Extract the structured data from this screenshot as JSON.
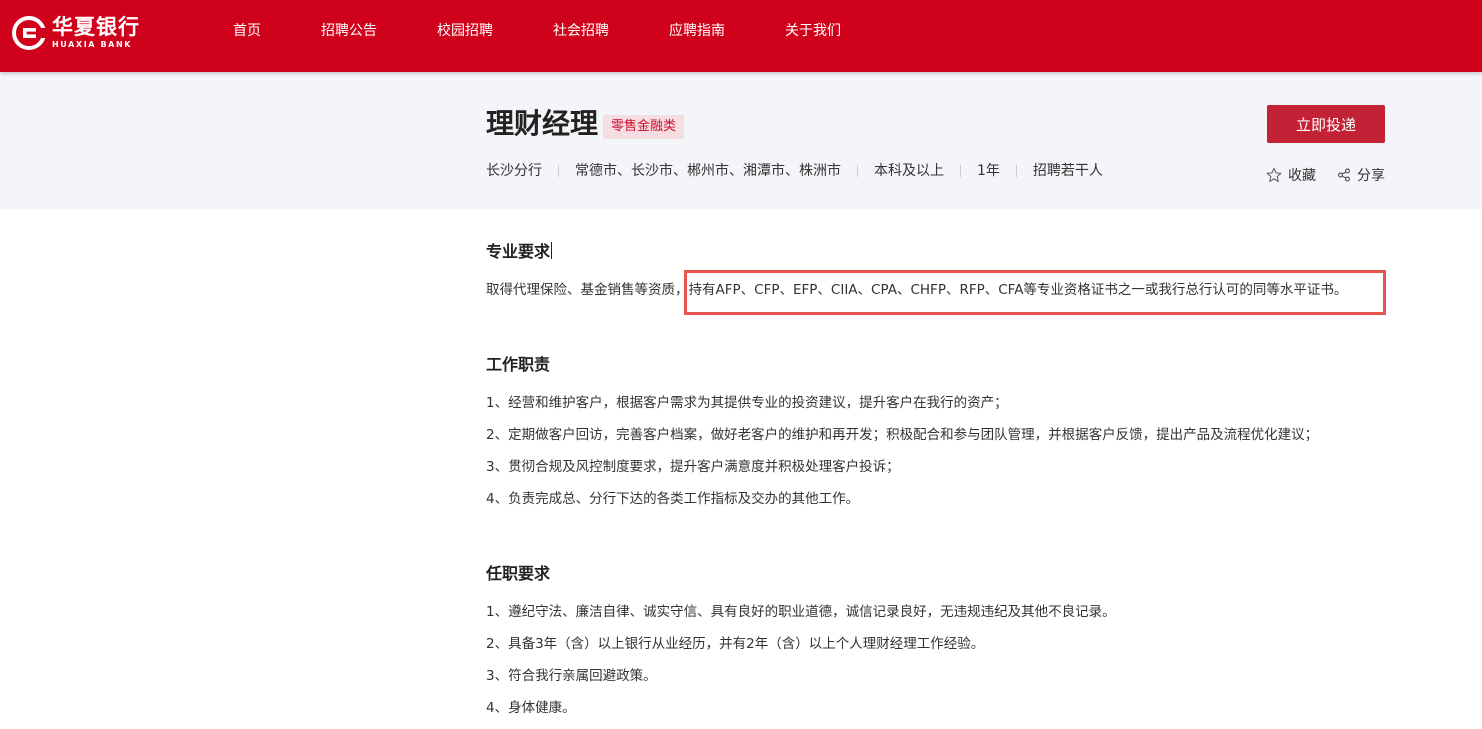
{
  "brand": {
    "name_cn": "华夏银行",
    "name_en": "HUAXIA BANK",
    "color": "#d0021b"
  },
  "nav": {
    "items": [
      {
        "label": "首页"
      },
      {
        "label": "招聘公告"
      },
      {
        "label": "校园招聘"
      },
      {
        "label": "社会招聘"
      },
      {
        "label": "应聘指南"
      },
      {
        "label": "关于我们"
      }
    ]
  },
  "job": {
    "title": "理财经理",
    "tag": "零售金融类",
    "meta": {
      "branch": "长沙分行",
      "cities": "常德市、长沙市、郴州市、湘潭市、株洲市",
      "education": "本科及以上",
      "experience": "1年",
      "headcount": "招聘若干人"
    },
    "apply_label": "立即投递",
    "favorite_label": "收藏",
    "share_label": "分享",
    "accent_color": "#c32136"
  },
  "sections": {
    "professional": {
      "title": "专业要求",
      "text": "取得代理保险、基金销售等资质，持有AFP、CFP、EFP、CIIA、CPA、CHFP、RFP、CFA等专业资格证书之一或我行总行认可的同等水平证书。"
    },
    "duties": {
      "title": "工作职责",
      "items": [
        " 1、经营和维护客户，根据客户需求为其提供专业的投资建议，提升客户在我行的资产；",
        "2、定期做客户回访，完善客户档案，做好老客户的维护和再开发；积极配合和参与团队管理，并根据客户反馈，提出产品及流程优化建议；",
        "3、贯彻合规及风控制度要求，提升客户满意度并积极处理客户投诉；",
        "4、负责完成总、分行下达的各类工作指标及交办的其他工作。"
      ]
    },
    "requirements": {
      "title": "任职要求",
      "items": [
        "1、遵纪守法、廉洁自律、诚实守信、具有良好的职业道德，诚信记录良好，无违规违纪及其他不良记录。",
        "2、具备3年（含）以上银行从业经历，并有2年（含）以上个人理财经理工作经验。",
        "3、符合我行亲属回避政策。",
        "4、身体健康。"
      ]
    }
  },
  "icons": {
    "favorite": "star-outline-icon",
    "share": "share-nodes-icon"
  }
}
